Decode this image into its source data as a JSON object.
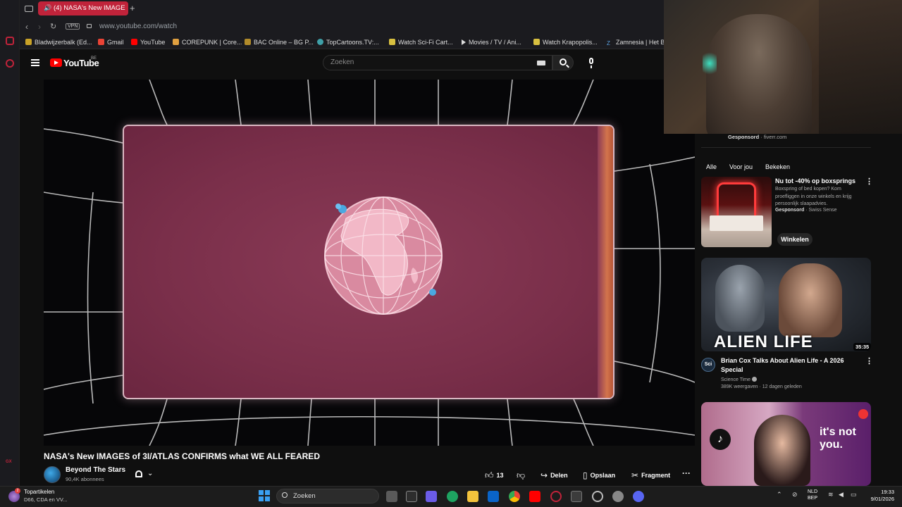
{
  "browser": {
    "active_tab_title": "(4) NASA's New IMAGE",
    "url": "www.youtube.com/watch",
    "vpn_label": "VPN",
    "bookmarks": [
      "Bladwijzerbalk (Ed...",
      "Gmail",
      "YouTube",
      "COREPUNK | Core...",
      "BAC Online – BG P...",
      "TopCartoons.TV:...",
      "Watch Sci-Fi Cart...",
      "Movies / TV / Ani...",
      "Watch Krapopolis...",
      "Zamnesia | Het Be"
    ],
    "bookmark_colors": [
      "#c9a227",
      "#ea4335",
      "#ff0000",
      "#e0a040",
      "#b08a2a",
      "#3fa0a8",
      "#d8c040",
      "#888888",
      "#d8c040",
      "#5aa0e0"
    ]
  },
  "youtube": {
    "logo_text": "YouTube",
    "country_code": "BE",
    "search_placeholder": "Zoeken",
    "video": {
      "title": "NASA's New IMAGES of 3I/ATLAS CONFIRMS what WE ALL FEARED",
      "channel_name": "Beyond The Stars",
      "subscribers": "90,4K abonnees",
      "like_count": "13",
      "share_label": "Delen",
      "save_label": "Opslaan",
      "clip_label": "Fragment",
      "more_label": "···"
    },
    "sidebar": {
      "top_ad_sponsored": "Gesponsord",
      "top_ad_domain": "· fiverr.com",
      "filter_chips": [
        "Alle",
        "Voor jou",
        "Bekeken"
      ],
      "ad": {
        "title": "Nu tot -40% op boxsprings",
        "description": "Boxspring of bed kopen? Kom proefliggen in onze winkels en krijg persoonlijk slaapadvies.",
        "sponsored": "Gesponsord",
        "advertiser": "· Swiss Sense",
        "cta": "Winkelen"
      },
      "videos": [
        {
          "thumb_text": "ALIEN LIFE",
          "duration": "35:35",
          "title": "Brian Cox Talks About Alien Life - A 2026 Special",
          "channel": "Science Time",
          "channel_avatar_text": "Sci",
          "meta": "389K weergaven · 12 dagen geleden"
        },
        {
          "thumb_text": "it's not you.",
          "duration": ""
        }
      ]
    }
  },
  "taskbar": {
    "news_title": "Topartikelen",
    "news_subtitle": "D66, CDA en VV...",
    "news_badge": "2",
    "search_label": "Zoeken",
    "language": "NLD",
    "language_sub": "BEP",
    "time": "19:33",
    "date": "9/01/2026"
  },
  "colors": {
    "accent_red": "#ff0000",
    "opera_red": "#c0233a",
    "video_screen": "#7a2f4a"
  }
}
